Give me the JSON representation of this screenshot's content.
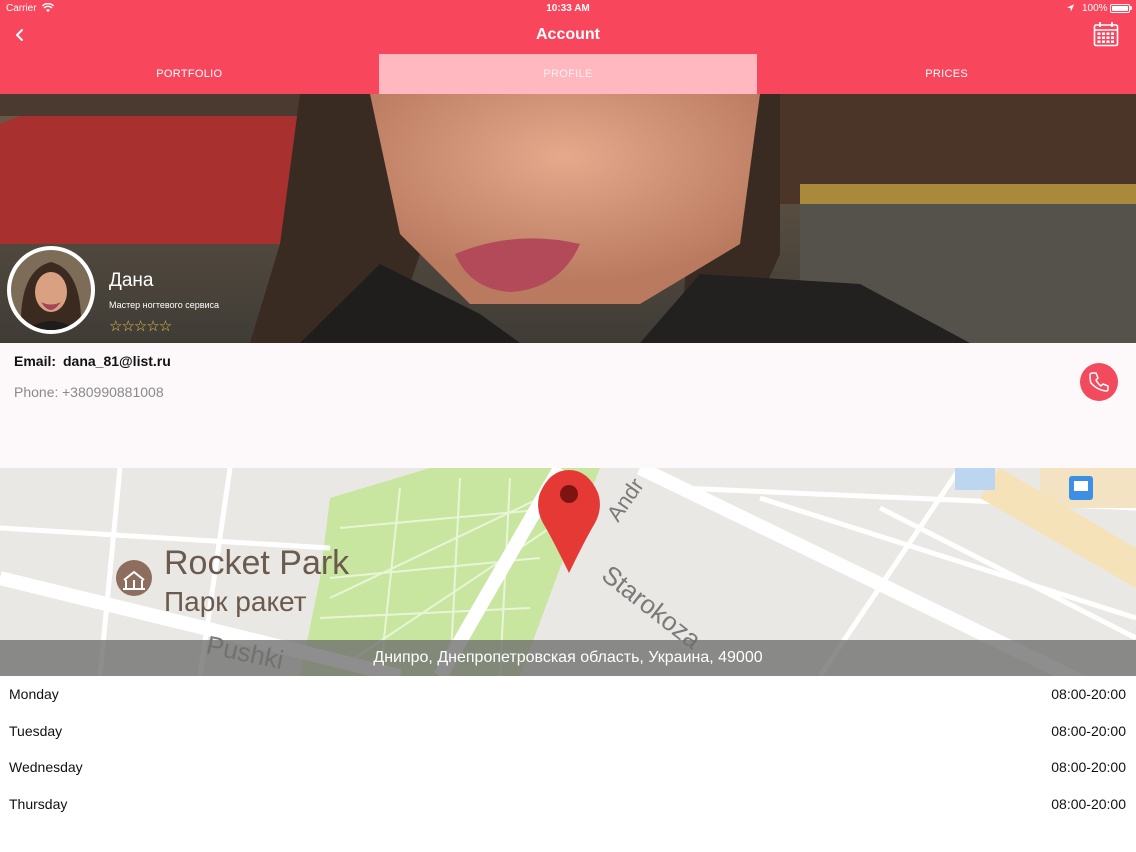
{
  "status_bar": {
    "carrier": "Carrier",
    "time": "10:33 AM",
    "battery": "100%"
  },
  "nav": {
    "title": "Account",
    "back_icon": "chevron-left-icon",
    "calendar_icon": "calendar-icon"
  },
  "tabs": [
    {
      "label": "PORTFOLIO",
      "active": false
    },
    {
      "label": "PROFILE",
      "active": true
    },
    {
      "label": "PRICES",
      "active": false
    }
  ],
  "profile": {
    "name": "Дана",
    "role": "Мастер ногтевого сервиса",
    "rating": 0,
    "rating_max": 5,
    "stars": "☆☆☆☆☆"
  },
  "contact": {
    "email_label": "Email:",
    "email": "dana_81@list.ru",
    "phone_label": "Phone:",
    "phone": "+380990881008"
  },
  "map": {
    "park_name_en": "Rocket Park",
    "park_name_ru": "Парк ракет",
    "street_1": "Starokoza",
    "street_2": "Pushki",
    "street_3": "Andr",
    "address": "Днипро, Днепропетровская область, Украина, 49000"
  },
  "schedule": [
    {
      "day": "Monday",
      "hours": "08:00-20:00"
    },
    {
      "day": "Tuesday",
      "hours": "08:00-20:00"
    },
    {
      "day": "Wednesday",
      "hours": "08:00-20:00"
    },
    {
      "day": "Thursday",
      "hours": "08:00-20:00"
    }
  ],
  "colors": {
    "accent": "#f8475c",
    "active_tab": "#ffb8c0",
    "call_button": "#f34a5d",
    "star": "#e3c04a"
  }
}
